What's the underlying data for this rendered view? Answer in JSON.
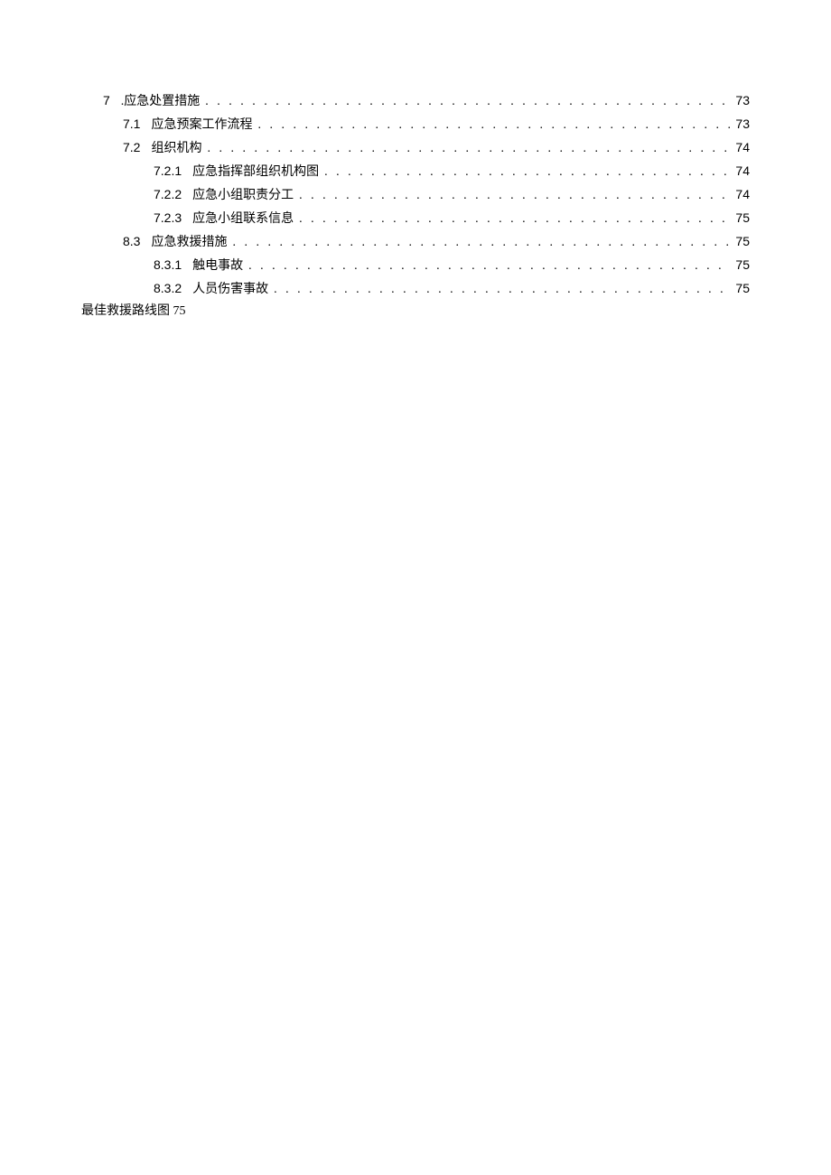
{
  "toc": [
    {
      "indent": 0,
      "num": "7",
      "title": ".应急处置措施",
      "page": "73"
    },
    {
      "indent": 1,
      "num": "7.1",
      "title": "应急预案工作流程",
      "page": "73"
    },
    {
      "indent": 1,
      "num": "7.2",
      "title": "组织机构",
      "page": "74"
    },
    {
      "indent": 2,
      "num": "7.2.1",
      "title": "应急指挥部组织机构图",
      "page": "74"
    },
    {
      "indent": 2,
      "num": "7.2.2",
      "title": "应急小组职责分工",
      "page": "74"
    },
    {
      "indent": 2,
      "num": "7.2.3",
      "title": "应急小组联系信息",
      "page": "75"
    },
    {
      "indent": 1,
      "num": "8.3",
      "title": "应急救援措施",
      "page": "75"
    },
    {
      "indent": 2,
      "num": "8.3.1",
      "title": "触电事故",
      "page": "75"
    },
    {
      "indent": 2,
      "num": "8.3.2",
      "title": "人员伤害事故",
      "page": "75"
    }
  ],
  "tail_line": "最佳救援路线图 75"
}
